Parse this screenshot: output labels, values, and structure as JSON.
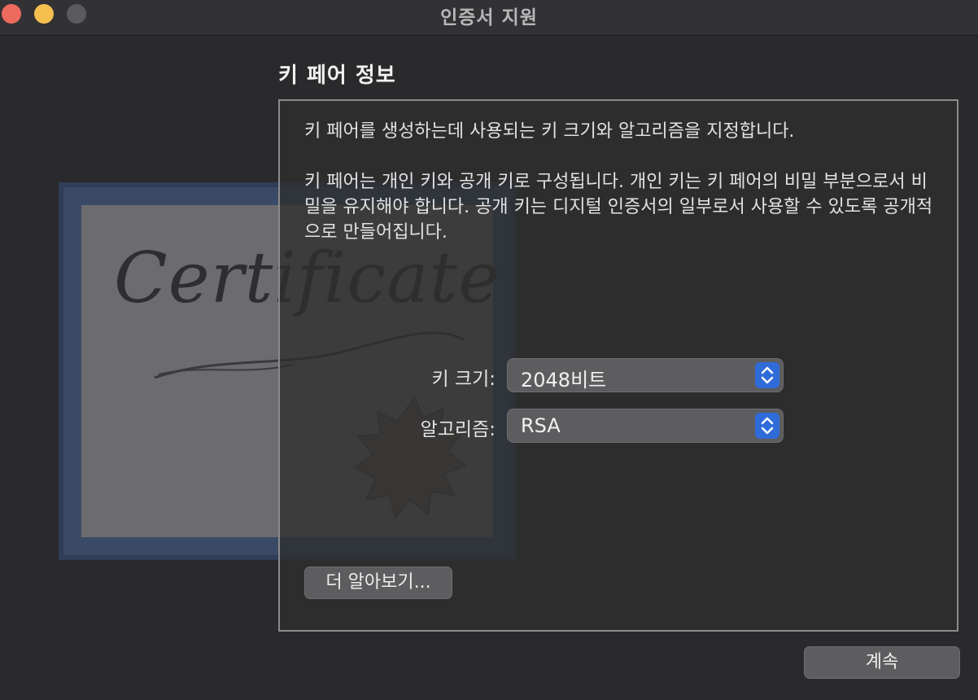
{
  "window": {
    "title": "인증서 지원"
  },
  "artwork": {
    "word": "Certificate"
  },
  "section": {
    "title": "키 페어 정보",
    "description_1": "키 페어를 생성하는데 사용되는 키 크기와 알고리즘을 지정합니다.",
    "description_2": "키 페어는 개인 키와 공개 키로 구성됩니다. 개인 키는 키 페어의 비밀 부분으로서 비밀을 유지해야 합니다. 공개 키는 디지털 인증서의 일부로서 사용할 수 있도록 공개적으로 만들어집니다."
  },
  "fields": {
    "key_size": {
      "label": "키 크기:",
      "value": "2048비트"
    },
    "algorithm": {
      "label": "알고리즘:",
      "value": "RSA"
    }
  },
  "buttons": {
    "learn_more": "더 알아보기...",
    "continue": "계속"
  },
  "colors": {
    "accent": "#2f6bd9",
    "close": "#ed6a5e",
    "minimize": "#f5bf4f",
    "zoom": "#5b5b5e"
  }
}
